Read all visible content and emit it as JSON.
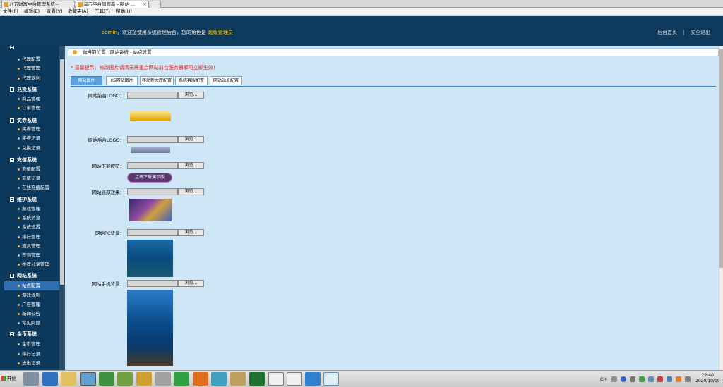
{
  "browser": {
    "tabs": [
      {
        "label": "八方财富中台管理系统 -"
      },
      {
        "label": "演示平台旗舰新 - 网站 ..."
      }
    ],
    "menu": [
      "文件(F)",
      "编辑(E)",
      "查看(V)",
      "收藏夹(A)",
      "工具(T)",
      "帮助(H)"
    ]
  },
  "header": {
    "user": "admin",
    "welcome": "，欢迎您使用系统管理后台，您的角色是",
    "role": "超级管理员",
    "links": [
      "后台首页",
      "安全退出"
    ]
  },
  "sidebar": {
    "top_items": [
      "代理配置",
      "代理管理",
      "代理返利"
    ],
    "groups": [
      {
        "title": "兑换系统",
        "items": [
          "商品管理",
          "订单管理"
        ]
      },
      {
        "title": "奖券系统",
        "items": [
          "奖券管理",
          "奖券记录",
          "兑换记录"
        ]
      },
      {
        "title": "充值系统",
        "items": [
          "充值配置",
          "充值记录",
          "在线充值配置"
        ]
      },
      {
        "title": "维护系统",
        "items": [
          "游戏管理",
          "系统消息",
          "系统设置",
          "排行管理",
          "道具管理",
          "签到管理",
          "推荐分享管理"
        ]
      },
      {
        "title": "网站系统",
        "items": [
          "站点配置",
          "游戏规则",
          "广告管理",
          "新闻公告",
          "常见问题"
        ]
      },
      {
        "title": "金币系统",
        "items": [
          "金币管理",
          "排行记录",
          "进出记录"
        ]
      }
    ],
    "active_item": "站点配置"
  },
  "content": {
    "breadcrumb": "你当前位置：网站系统 - 站点设置",
    "tip": "* 温馨提示：修改图片请清无需重启网站前台服务器即可立即生效！",
    "tabs": [
      "网站图片",
      "H5网站图片",
      "移动新大厅配置",
      "系统客服配置",
      "网站站点配置"
    ],
    "browse_label": "浏览...",
    "fields": [
      {
        "label": "网站前台LOGO："
      },
      {
        "label": "网站后台LOGO："
      },
      {
        "label": "网站下载按钮："
      },
      {
        "label": "网站底部效果："
      },
      {
        "label": "网站PC背景："
      },
      {
        "label": "网站手机背景："
      }
    ],
    "download_button_preview": "点击下载演示版"
  },
  "taskbar": {
    "start": "开始",
    "lang": "CH",
    "time": "22:40",
    "date": "2020/10/19"
  },
  "colors": {
    "header_bg": "#0e3a5e",
    "sidebar_bg": "#0d3a5c",
    "content_bg": "#cfe6f6",
    "tip_red": "#e02020",
    "role_gold": "#ffcc00"
  }
}
